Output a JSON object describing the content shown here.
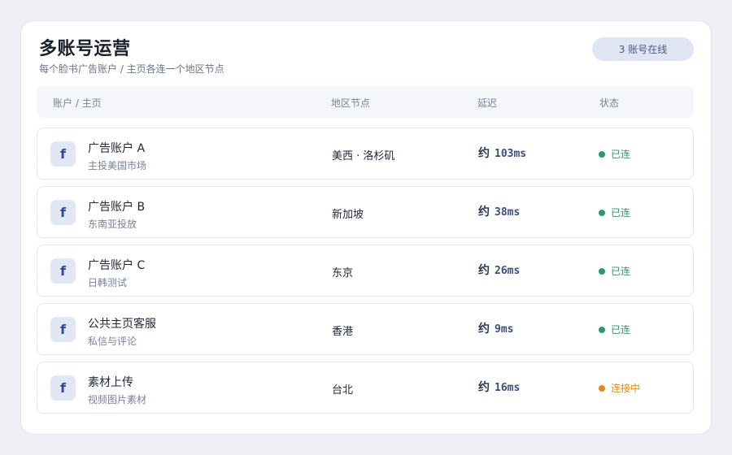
{
  "header": {
    "title": "多账号运营",
    "subtitle": "每个脸书广告账户 / 主页各连一个地区节点",
    "online_badge": "3 账号在线"
  },
  "columns": {
    "account": "账户 / 主页",
    "region": "地区节点",
    "latency": "延迟",
    "status": "状态"
  },
  "latency_prefix": "约",
  "icon_glyph": "f",
  "colors": {
    "connected": "#2f9a63",
    "connecting": "#e08a1e"
  },
  "rows": [
    {
      "name": "广告账户 A",
      "desc": "主投美国市场",
      "region": "美西 · 洛杉矶",
      "latency": "103ms",
      "status": "已连",
      "state": "connected"
    },
    {
      "name": "广告账户 B",
      "desc": "东南亚投放",
      "region": "新加坡",
      "latency": "38ms",
      "status": "已连",
      "state": "connected"
    },
    {
      "name": "广告账户 C",
      "desc": "日韩测试",
      "region": "东京",
      "latency": "26ms",
      "status": "已连",
      "state": "connected"
    },
    {
      "name": "公共主页客服",
      "desc": "私信与评论",
      "region": "香港",
      "latency": "9ms",
      "status": "已连",
      "state": "connected"
    },
    {
      "name": "素材上传",
      "desc": "视频图片素材",
      "region": "台北",
      "latency": "16ms",
      "status": "连接中",
      "state": "connecting"
    }
  ]
}
